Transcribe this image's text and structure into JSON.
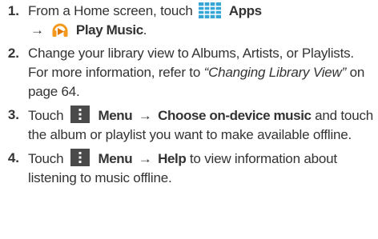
{
  "steps": [
    {
      "number": "1.",
      "text_a": "From a Home screen, touch",
      "apps_label": "Apps",
      "arrow": "→",
      "play_music_label": "Play Music",
      "period": "."
    },
    {
      "number": "2.",
      "text_a": "Change your library view to Albums, Artists, or Playlists. For more information, refer to",
      "ref_title": "“Changing Library View”",
      "text_b": "on page 64."
    },
    {
      "number": "3.",
      "text_a": "Touch",
      "menu_label": "Menu",
      "arrow": "→",
      "option_label": "Choose on-device music",
      "text_b": "and touch the album or playlist you want to make available offline."
    },
    {
      "number": "4.",
      "text_a": "Touch",
      "menu_label": "Menu",
      "arrow": "→",
      "help_label": "Help",
      "text_b": "to view information about listening to music offline."
    }
  ],
  "icons": {
    "apps": "apps-grid-icon",
    "play_music": "play-music-headphones-icon",
    "menu": "menu-overflow-icon"
  },
  "colors": {
    "apps_icon": "#35a6d6",
    "play_music_orange": "#f39a1e",
    "menu_icon_bg": "#4a4a4a",
    "text": "#333333"
  }
}
